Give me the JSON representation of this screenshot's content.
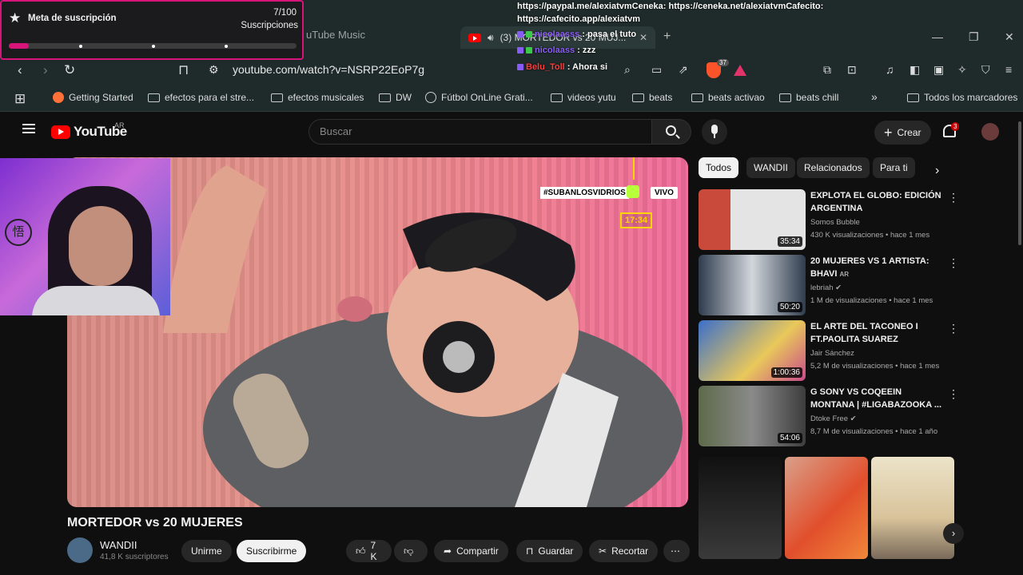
{
  "browser": {
    "ghost_tab": "uTube Music",
    "active_tab": "(3) MORTEDOR vs 20 MUJ...",
    "url": "youtube.com/watch?v=NSRP22EoP7g",
    "brave_badge": "37",
    "bookmarks": [
      {
        "label": "Getting Started",
        "icon": "firefox-icon"
      },
      {
        "label": "efectos para el stre...",
        "icon": "folder-icon"
      },
      {
        "label": "efectos musicales",
        "icon": "folder-icon"
      },
      {
        "label": "DW",
        "icon": "folder-icon"
      },
      {
        "label": "Fútbol OnLine Grati...",
        "icon": "globe-icon"
      },
      {
        "label": "videos yutu",
        "icon": "folder-icon"
      },
      {
        "label": "beats",
        "icon": "folder-icon"
      },
      {
        "label": "beats activao",
        "icon": "folder-icon"
      },
      {
        "label": "beats chill",
        "icon": "folder-icon"
      }
    ],
    "all_bookmarks": "Todos los marcadores",
    "overflow": "»"
  },
  "overlay": {
    "goal_title": "Meta de suscripción",
    "goal_count": "7/100",
    "goal_label": "Suscripciones",
    "goal_progress": 0.07,
    "links_line1": "https://paypal.me/alexiatvmCeneka: https://ceneka.net/alexiatvmCafecito:",
    "links_line2": "https://cafecito.app/alexiatvm",
    "chat": [
      {
        "user": "nicolaasss",
        "user_color": "#8a5cf6",
        "message": ": pasa el tuto"
      },
      {
        "user": "nicolaass",
        "user_color": "#8a5cf6",
        "message": ": zzz"
      },
      {
        "user": "Belu_Toll",
        "user_color": "#ff3b3b",
        "message": ": Ahora si"
      }
    ]
  },
  "youtube": {
    "logo": "YouTube",
    "region": "AR",
    "search_placeholder": "Buscar",
    "create": "Crear",
    "notifications": "3",
    "video_title": "MORTEDOR vs 20 MUJERES",
    "overlay_hashtag": "#SUBANLOSVIDRIOS",
    "overlay_live": "VIVO",
    "overlay_timer": "17:34",
    "channel": "WANDII",
    "subscribers": "41,8 K suscriptores",
    "join": "Unirme",
    "subscribe": "Suscribirme",
    "likes": "7 K",
    "share": "Compartir",
    "save": "Guardar",
    "clip": "Recortar",
    "chips": [
      "Todos",
      "WANDII",
      "Relacionados",
      "Para ti"
    ],
    "recommendations": [
      {
        "title": "EXPLOTA EL GLOBO: EDICIÓN ARGENTINA",
        "channel": "Somos Bubble",
        "meta": "430 K visualizaciones • hace 1 mes",
        "duration": "35:34",
        "color": "#b9a6a0"
      },
      {
        "title": "20 MUJERES VS 1 ARTISTA: BHAVI",
        "title_badge": "AR",
        "channel": "lebriah",
        "meta": "1 M de visualizaciones • hace 1 mes",
        "duration": "50:20",
        "color": "#c9504a"
      },
      {
        "title": "EL ARTE DEL TACONEO  I FT.PAOLITA SUAREZ",
        "channel": "Jair Sánchez",
        "meta": "5,2 M de visualizaciones • hace 1 mes",
        "duration": "1:00:36",
        "color": "#3c6fc9"
      },
      {
        "title": "G SONY VS COQEEIN MONTANA | #LIGABAZOOKA ...",
        "channel": "Dtoke Free",
        "meta": "8,7 M de visualizaciones • hace 1 año",
        "duration": "54:06",
        "color": "#5d6a4a"
      }
    ]
  }
}
